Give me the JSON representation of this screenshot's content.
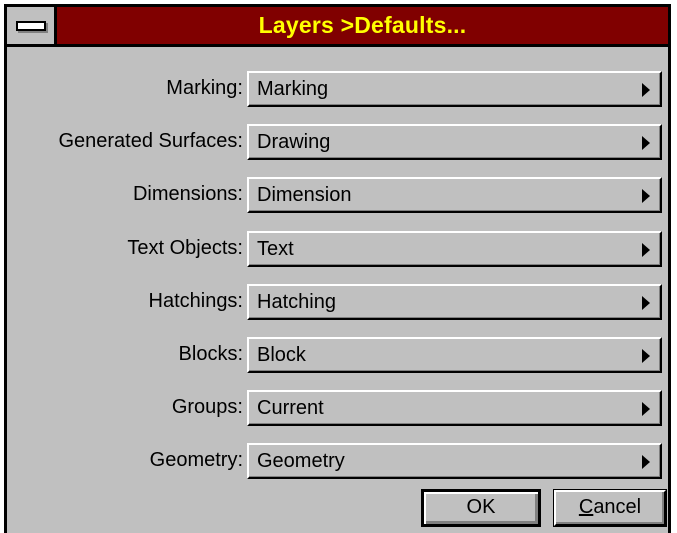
{
  "window": {
    "title": "Layers >Defaults..."
  },
  "fields": [
    {
      "label": "Marking:",
      "value": "Marking"
    },
    {
      "label": "Generated Surfaces:",
      "value": "Drawing"
    },
    {
      "label": "Dimensions:",
      "value": "Dimension"
    },
    {
      "label": "Text Objects:",
      "value": "Text"
    },
    {
      "label": "Hatchings:",
      "value": "Hatching"
    },
    {
      "label": "Blocks:",
      "value": "Block"
    },
    {
      "label": "Groups:",
      "value": "Current"
    },
    {
      "label": "Geometry:",
      "value": "Geometry"
    }
  ],
  "buttons": {
    "ok_label": "OK",
    "cancel_mnemonic": "C",
    "cancel_rest": "ancel"
  },
  "icons": {
    "system_menu": "system-menu-icon",
    "dropdown_arrow": "right-triangle-arrow-icon"
  },
  "colors": {
    "titlebar": "#800000",
    "title_text": "#ffff00",
    "face": "#c0c0c0"
  }
}
